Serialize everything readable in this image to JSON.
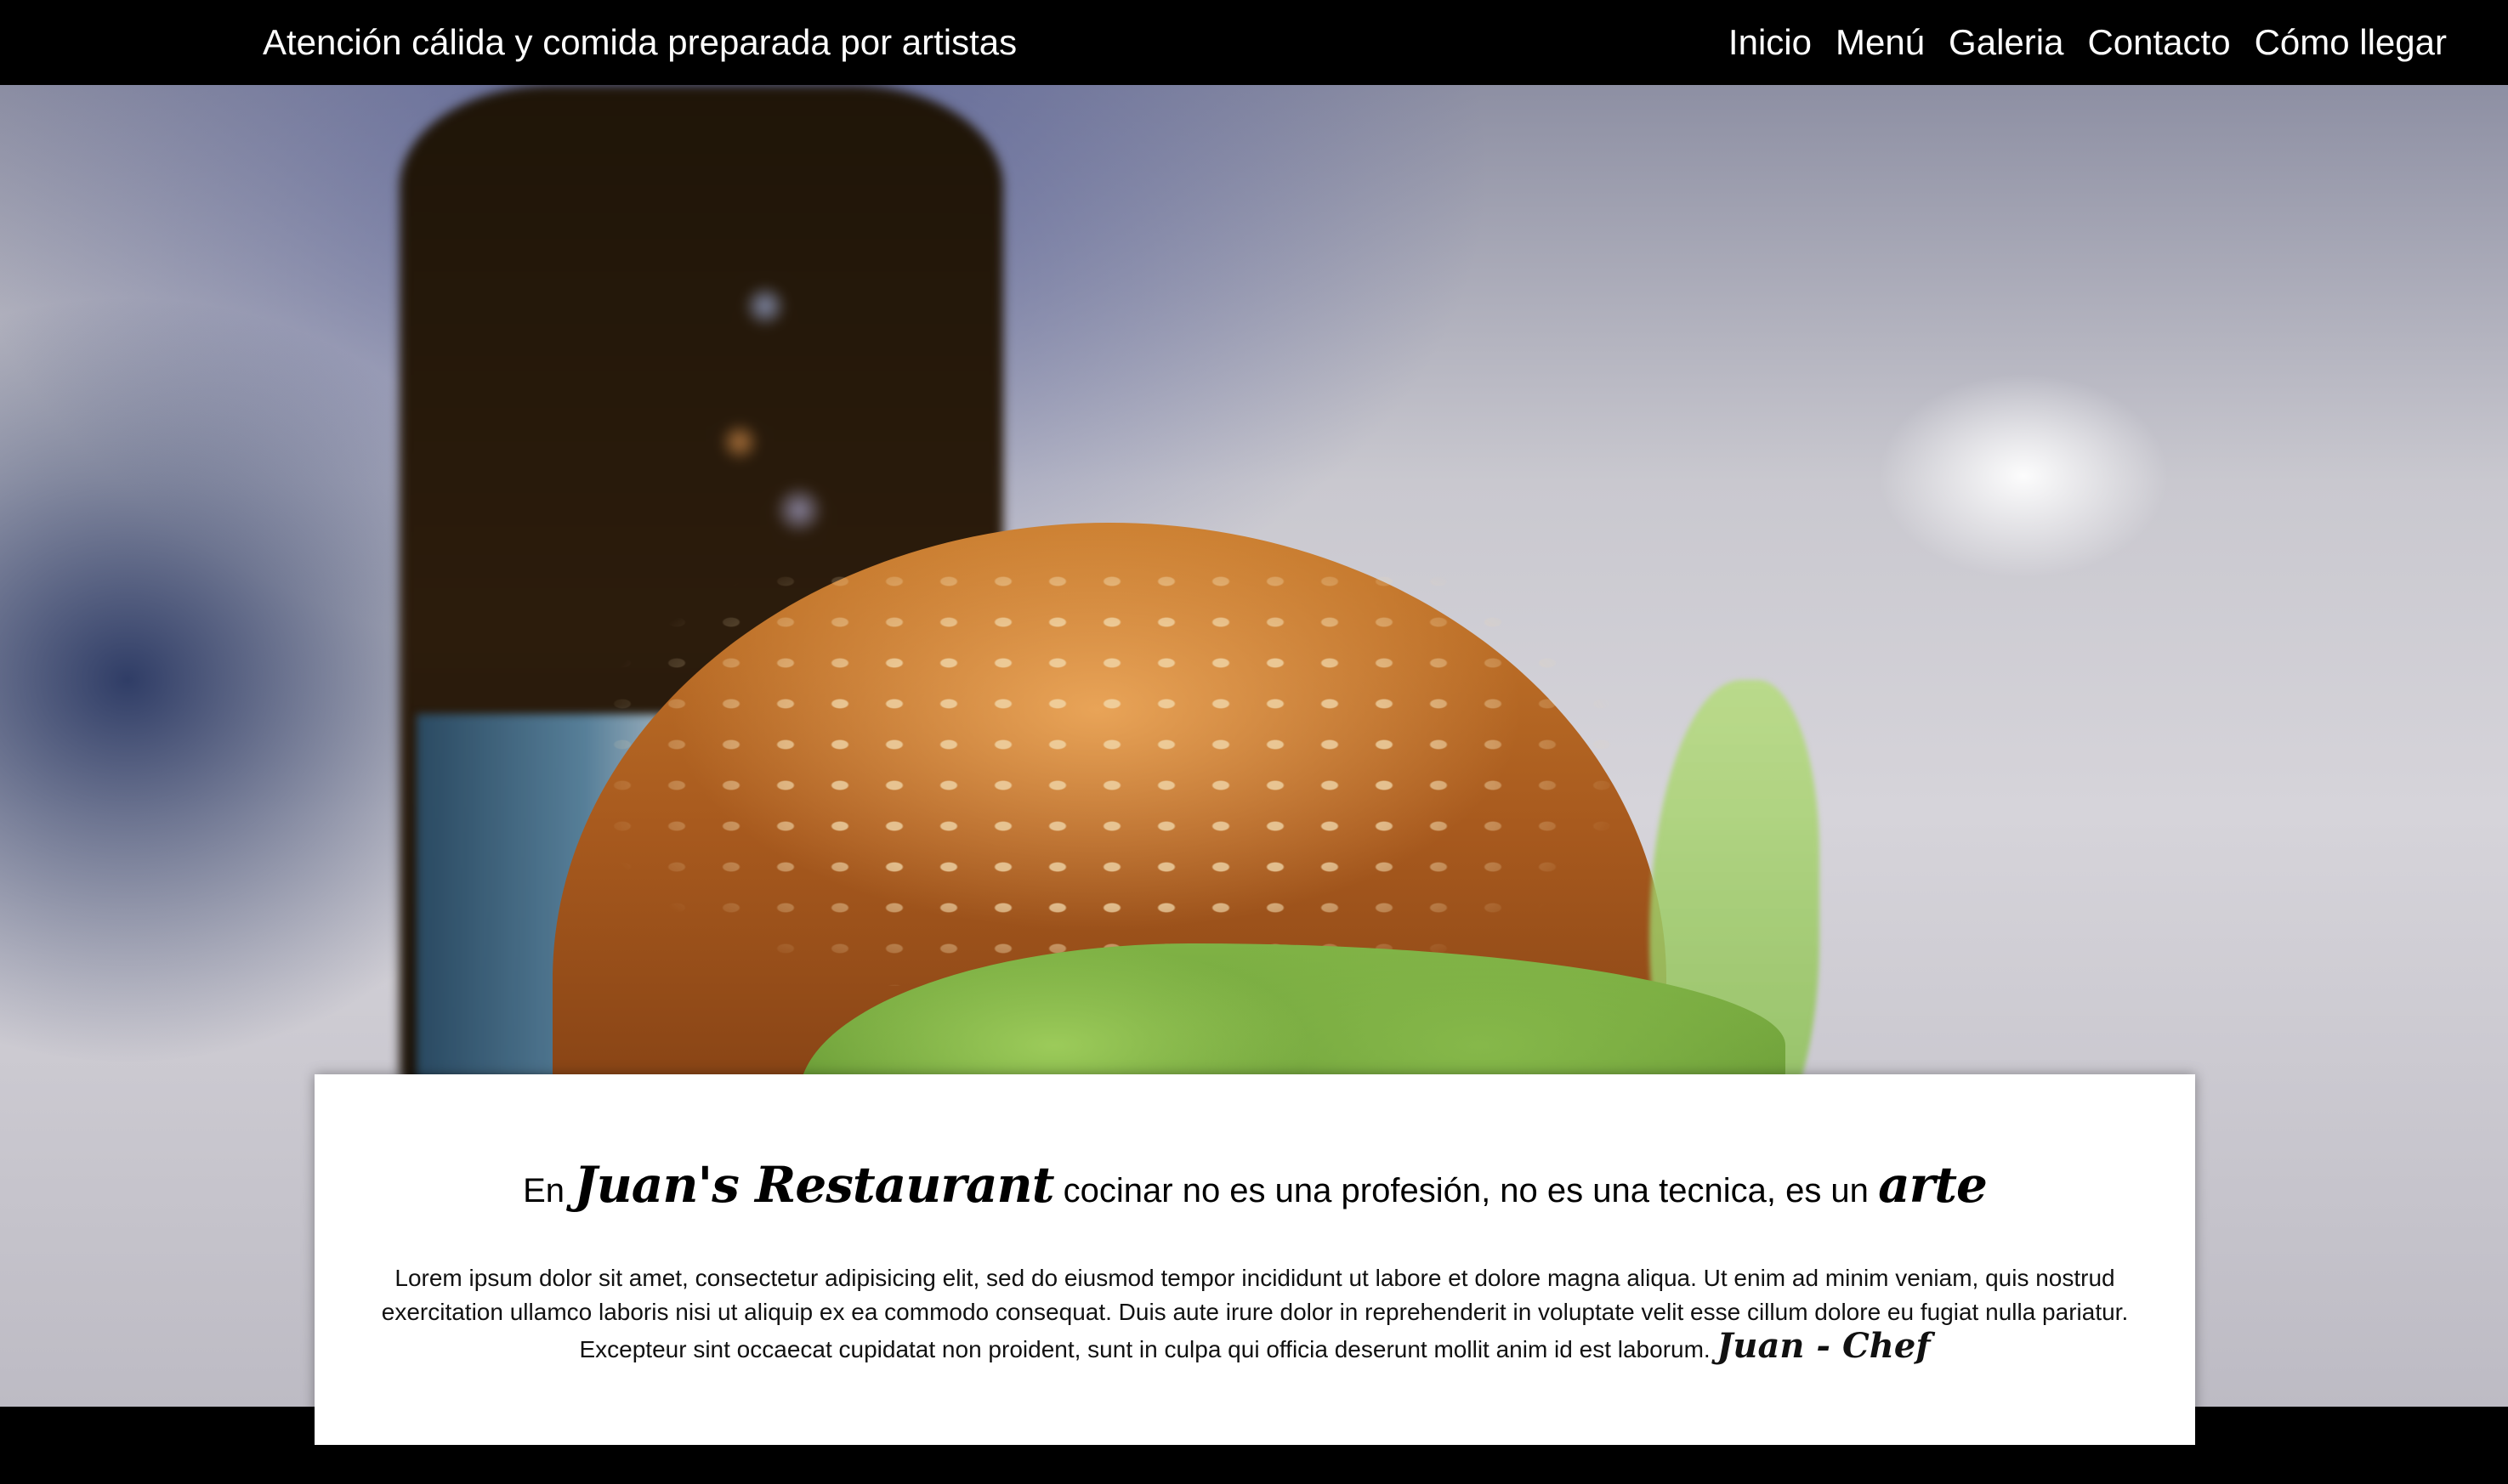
{
  "header": {
    "tagline": "Atención cálida y comida preparada por artistas",
    "nav": [
      "Inicio",
      "Menú",
      "Galeria",
      "Contacto",
      "Cómo llegar"
    ]
  },
  "hero": {
    "image_description_icon": "burger-photo"
  },
  "intro": {
    "prefix": "En",
    "restaurant_name": "Juan's Restaurant",
    "middle": "cocinar no es una profesión, no es una tecnica, es un",
    "emphasis": "arte",
    "body": "Lorem ipsum dolor sit amet, consectetur adipisicing elit, sed do eiusmod tempor incididunt ut labore et dolore magna aliqua. Ut enim ad minim veniam, quis nostrud exercitation ullamco laboris nisi ut aliquip ex ea commodo consequat. Duis aute irure dolor in reprehenderit in voluptate velit esse cillum dolore eu fugiat nulla pariatur. Excepteur sint occaecat cupidatat non proident, sunt in culpa qui officia deserunt mollit anim id est laborum.",
    "signature": "Juan - Chef"
  }
}
